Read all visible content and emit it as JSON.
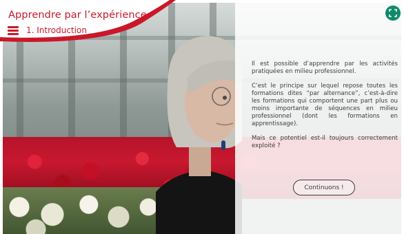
{
  "header": {
    "title": "Apprendre par l’expérience",
    "section": "1. Introduction"
  },
  "content": {
    "paragraphs": [
      "Il est possible d’apprendre par les activités pratiquées en milieu professionnel.",
      "C’est le principe sur lequel repose toutes les formations dites “par alternance”, c’est-à-dire les formations qui comportent une part plus ou moins importante de séquences en milieu professionnel (dont les formations en apprentissage).",
      "Mais ce potentiel est-il toujours correctement exploité ?"
    ],
    "continue_label": "Continuons !"
  },
  "icons": {
    "menu": "hamburger-menu-icon",
    "fullscreen": "fullscreen-icon"
  },
  "colors": {
    "accent": "#c9182a",
    "fullscreen_button": "#0f8a6a"
  }
}
